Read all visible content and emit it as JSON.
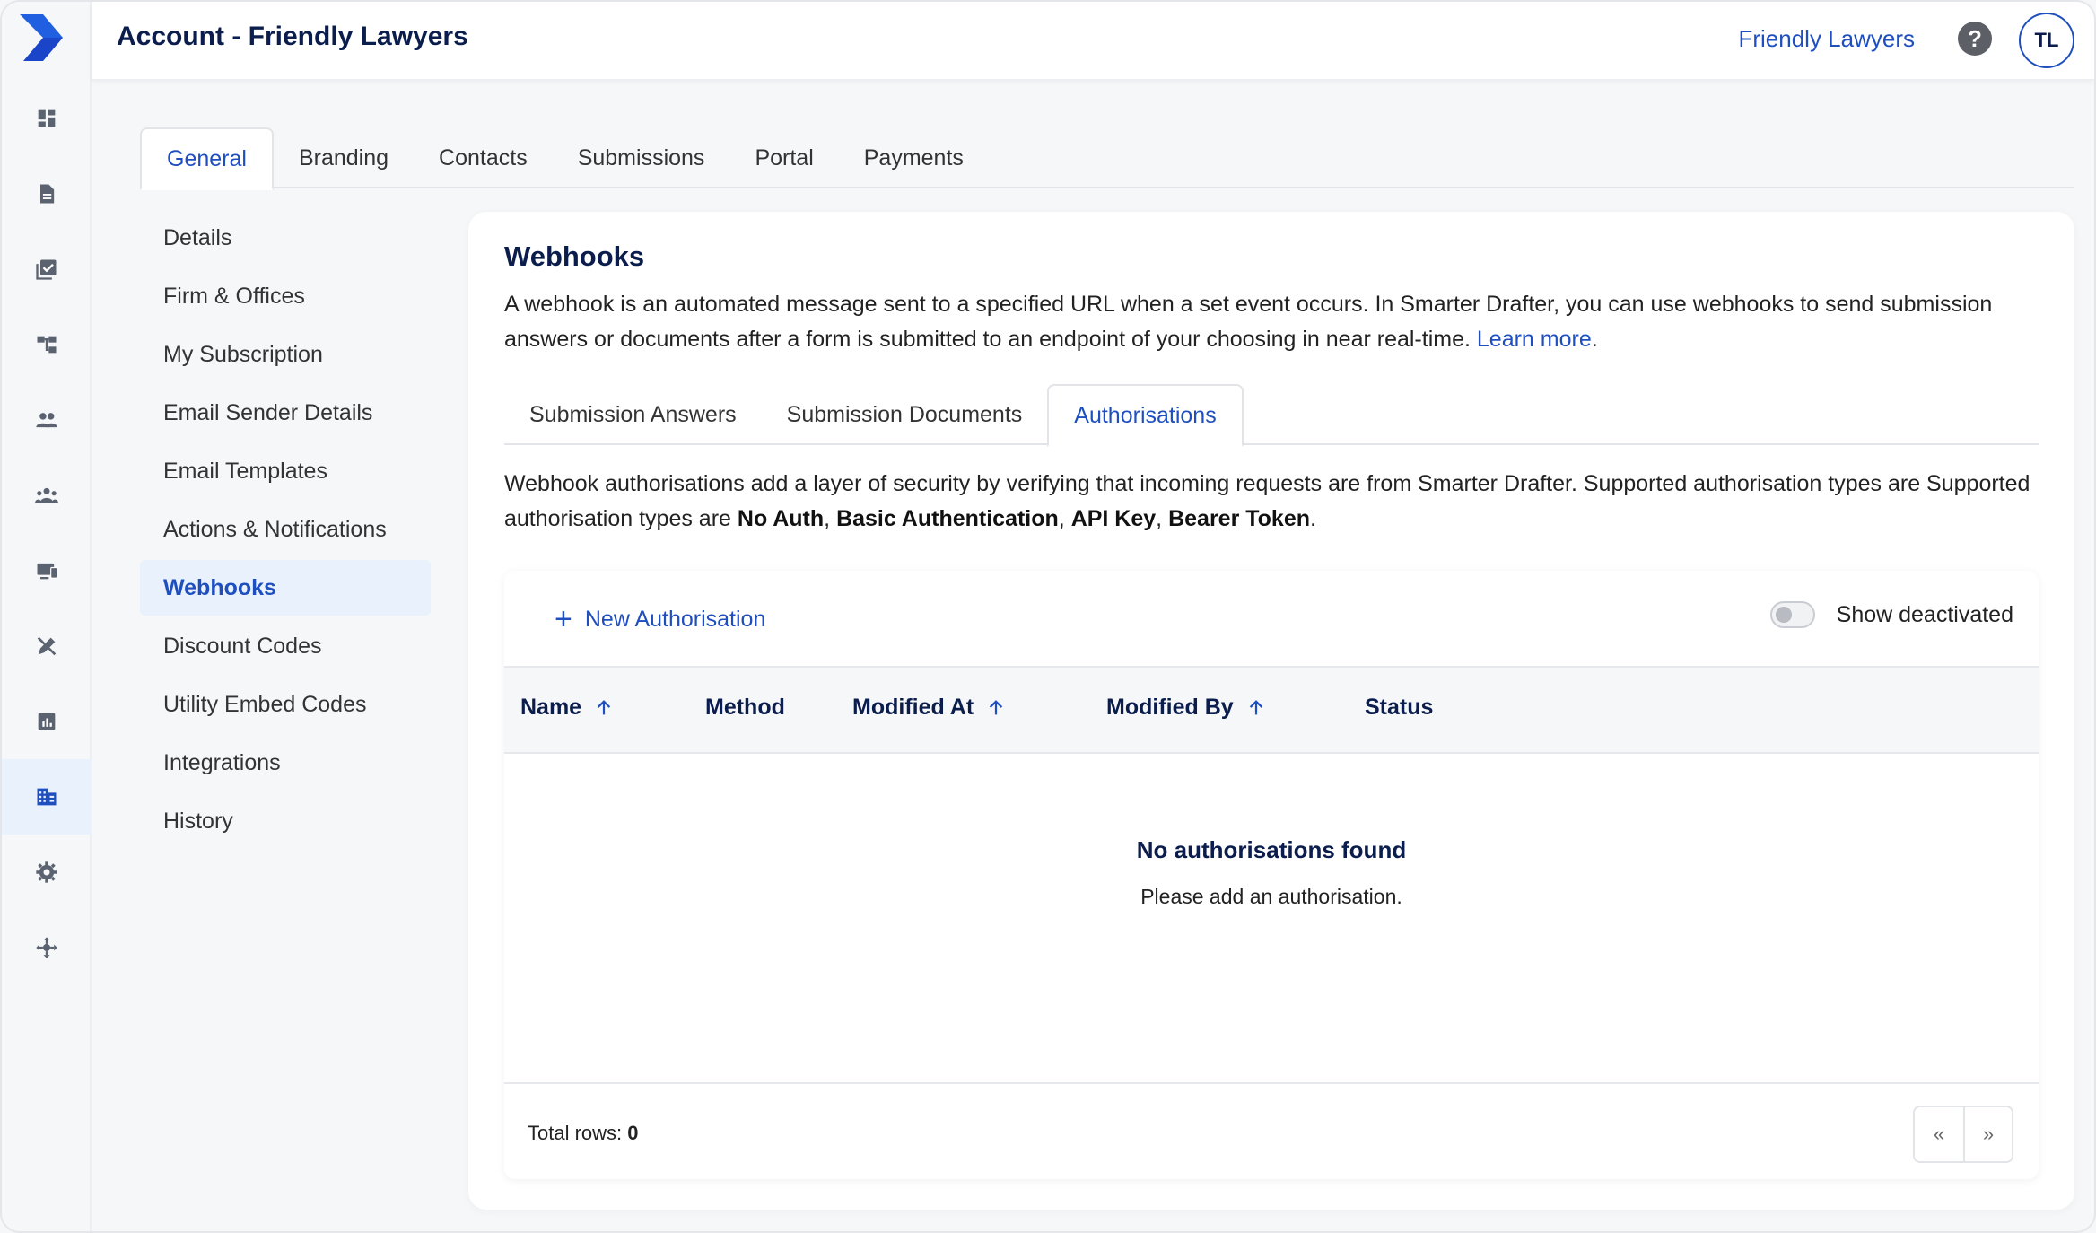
{
  "header": {
    "title": "Account - Friendly Lawyers",
    "firm_name": "Friendly Lawyers",
    "help_glyph": "?",
    "avatar_initials": "TL"
  },
  "rail": {
    "icons": [
      "logo-icon",
      "dashboard-icon",
      "document-icon",
      "checklist-icon",
      "workflow-icon",
      "contacts-icon",
      "team-icon",
      "portal-icon",
      "design-icon",
      "reports-icon",
      "account-building-icon",
      "settings-gear-icon",
      "integrations-icon"
    ],
    "active": "account-building-icon"
  },
  "top_tabs": [
    {
      "label": "General",
      "active": true
    },
    {
      "label": "Branding",
      "active": false
    },
    {
      "label": "Contacts",
      "active": false
    },
    {
      "label": "Submissions",
      "active": false
    },
    {
      "label": "Portal",
      "active": false
    },
    {
      "label": "Payments",
      "active": false
    }
  ],
  "side_menu": [
    {
      "label": "Details",
      "active": false
    },
    {
      "label": "Firm & Offices",
      "active": false
    },
    {
      "label": "My Subscription",
      "active": false
    },
    {
      "label": "Email Sender Details",
      "active": false
    },
    {
      "label": "Email Templates",
      "active": false
    },
    {
      "label": "Actions & Notifications",
      "active": false
    },
    {
      "label": "Webhooks",
      "active": true
    },
    {
      "label": "Discount Codes",
      "active": false
    },
    {
      "label": "Utility Embed Codes",
      "active": false
    },
    {
      "label": "Integrations",
      "active": false
    },
    {
      "label": "History",
      "active": false
    }
  ],
  "webhooks": {
    "heading": "Webhooks",
    "description": "A webhook is an automated message sent to a specified URL when a set event occurs. In Smarter Drafter, you can use webhooks to send submission answers or documents after a form is submitted to an endpoint of your choosing in near real-time.",
    "learn_more": "Learn more",
    "learn_more_suffix": "."
  },
  "inner_tabs": [
    {
      "label": "Submission Answers",
      "active": false
    },
    {
      "label": "Submission Documents",
      "active": false
    },
    {
      "label": "Authorisations",
      "active": true
    }
  ],
  "auth_description": {
    "intro": "Webhook authorisations add a layer of security by verifying that incoming requests are from Smarter Drafter. Supported authorisation types are Supported authorisation types are ",
    "types": [
      "No Auth",
      "Basic Authentication",
      "API Key",
      "Bearer Token"
    ],
    "separator": ", ",
    "end": "."
  },
  "table": {
    "new_button": "New Authorisation",
    "toggle_label": "Show deactivated",
    "toggle_on": false,
    "columns": [
      {
        "label": "Name",
        "sort": "asc"
      },
      {
        "label": "Method",
        "sort": null
      },
      {
        "label": "Modified At",
        "sort": "asc"
      },
      {
        "label": "Modified By",
        "sort": "asc"
      },
      {
        "label": "Status",
        "sort": null
      }
    ],
    "empty_title": "No authorisations found",
    "empty_subtitle": "Please add an authorisation.",
    "total_label": "Total rows: ",
    "total_value": "0",
    "pager_prev": "«",
    "pager_next": "»"
  },
  "colors": {
    "accent": "#1f4fbf",
    "navy": "#0b1d4d",
    "active_bg": "#e9f1fd"
  }
}
